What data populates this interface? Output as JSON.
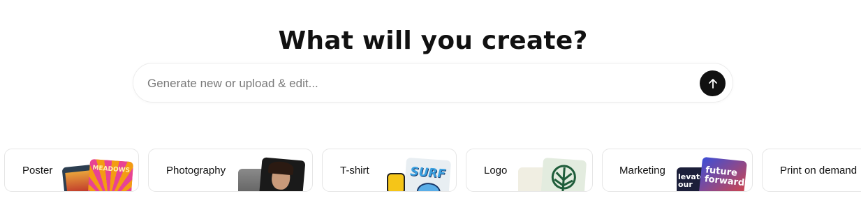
{
  "heading": "What will you create?",
  "search": {
    "placeholder": "Generate new or upload & edit...",
    "submit_icon": "arrow-up-icon"
  },
  "categories": [
    {
      "label": "Poster",
      "thumb_text": [
        "MEADOWS"
      ]
    },
    {
      "label": "Photography"
    },
    {
      "label": "T-shirt",
      "thumb_text": [
        "SURF"
      ]
    },
    {
      "label": "Logo"
    },
    {
      "label": "Marketing",
      "thumb_text": [
        "future",
        "forward",
        "levate",
        "our"
      ]
    },
    {
      "label": "Print on demand"
    }
  ],
  "colors": {
    "accent": "#111111",
    "border": "#e6e6e6",
    "placeholder": "#7a7a7a"
  }
}
